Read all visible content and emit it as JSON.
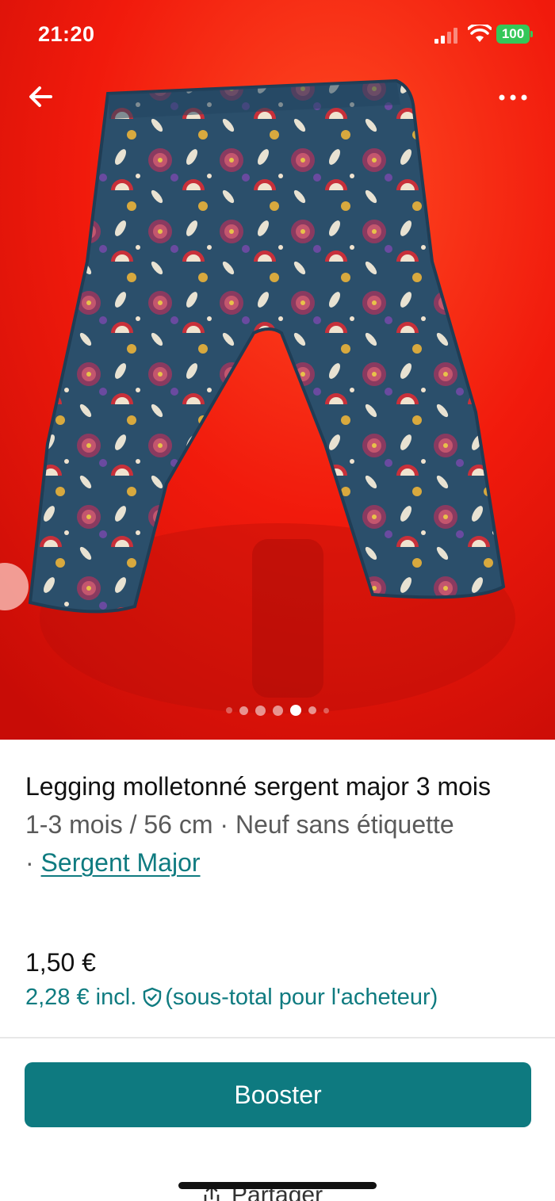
{
  "status_bar": {
    "time": "21:20",
    "battery_level": "100",
    "icons": [
      "signal-icon",
      "wifi-icon",
      "battery-icon"
    ]
  },
  "top_nav": {
    "icons": [
      "back-arrow-icon",
      "more-icon"
    ]
  },
  "gallery": {
    "image_count": 7,
    "active_index": 4,
    "background_color": "#e8160b"
  },
  "product": {
    "title": "Legging molletonné sergent major 3 mois",
    "details": "1-3 mois / 56 cm · Neuf sans étiquette",
    "brand_separator": "· ",
    "brand": "Sergent Major",
    "price": "1,50 €",
    "price_incl": "2,28 € incl.",
    "price_incl_note": "(sous-total pour l'acheteur)"
  },
  "actions": {
    "booster_label": "Booster",
    "share_label": "Partager"
  },
  "colors": {
    "accent": "#0e7a80",
    "text_muted": "#5a5a5a"
  }
}
